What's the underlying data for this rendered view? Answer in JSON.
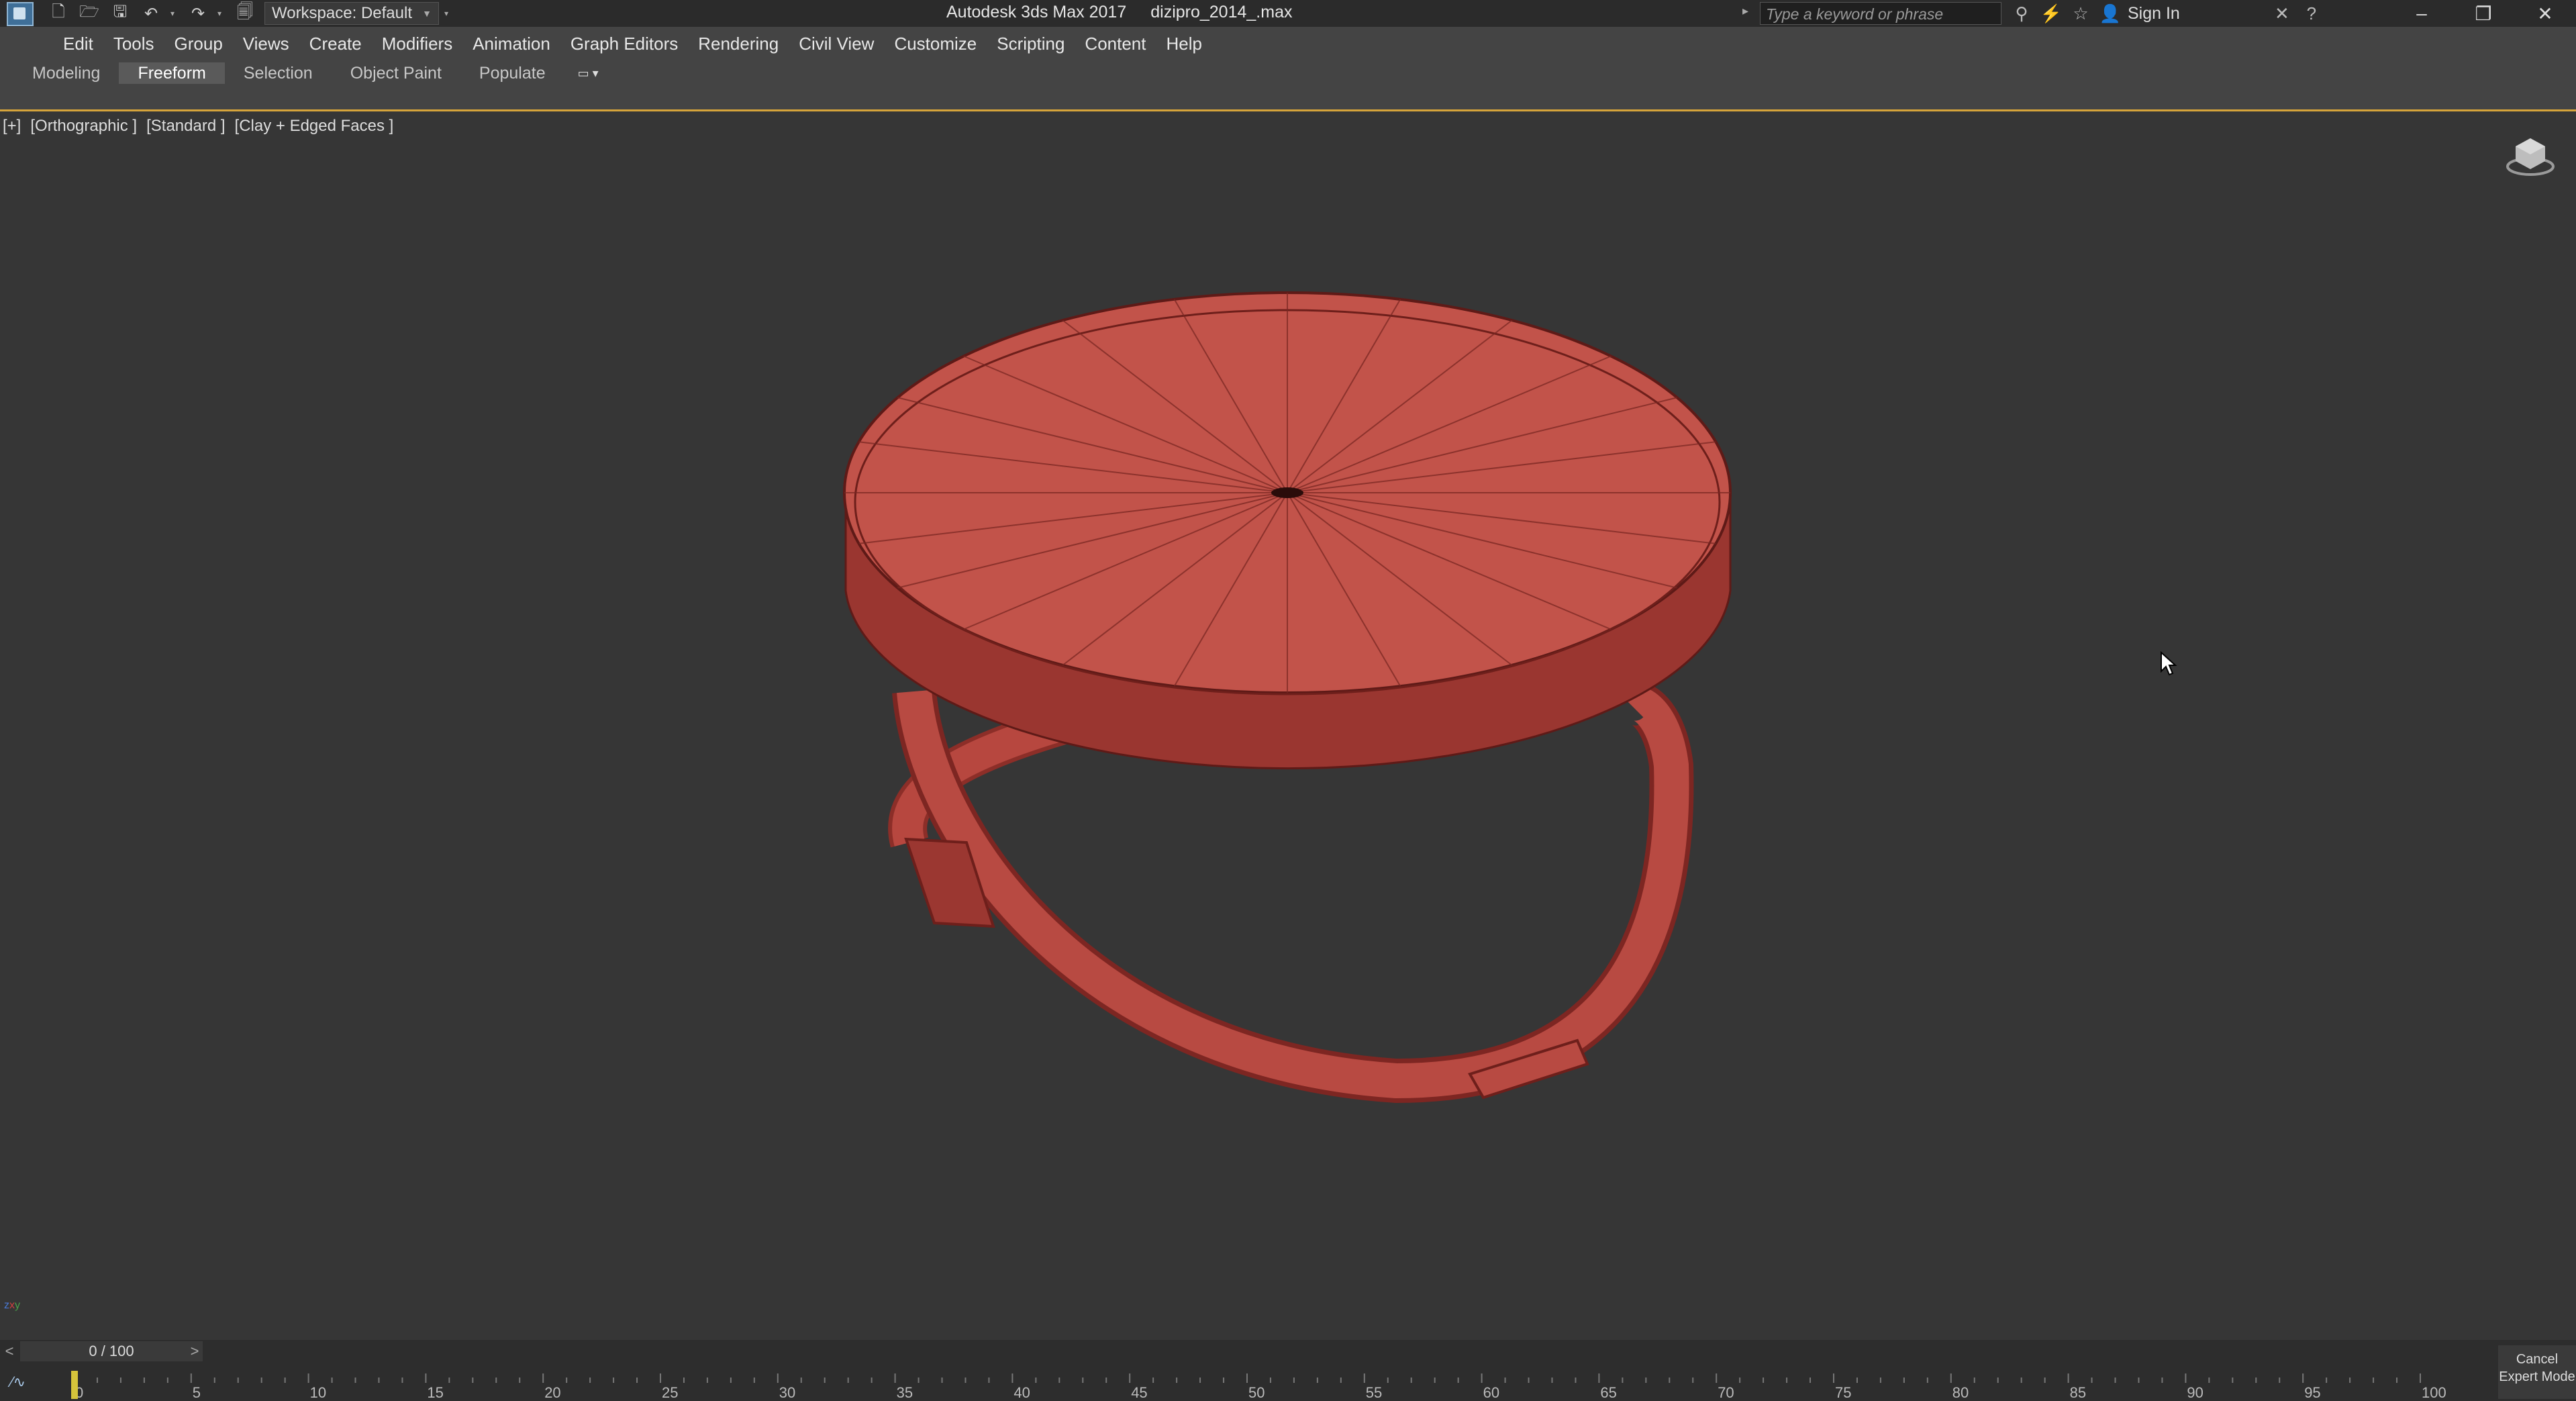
{
  "app": {
    "title": "Autodesk 3ds Max 2017",
    "file": "dizipro_2014_.max",
    "workspace_label": "Workspace: Default"
  },
  "search": {
    "placeholder": "Type a keyword or phrase"
  },
  "account": {
    "signin_label": "Sign In"
  },
  "menu": [
    "Edit",
    "Tools",
    "Group",
    "Views",
    "Create",
    "Modifiers",
    "Animation",
    "Graph Editors",
    "Rendering",
    "Civil View",
    "Customize",
    "Scripting",
    "Content",
    "Help"
  ],
  "ribbon_tabs": [
    {
      "label": "Modeling",
      "active": false
    },
    {
      "label": "Freeform",
      "active": true
    },
    {
      "label": "Selection",
      "active": false
    },
    {
      "label": "Object Paint",
      "active": false
    },
    {
      "label": "Populate",
      "active": false
    }
  ],
  "viewport": {
    "labels": [
      "[+]",
      "[Orthographic ]",
      "[Standard ]",
      "[Clay + Edged Faces ]"
    ],
    "object_color": "#b84a42"
  },
  "timeline": {
    "frame_display": "0 / 100",
    "prev_label": "<",
    "next_label": ">",
    "ticks": [
      "0",
      "5",
      "10",
      "15",
      "20",
      "25",
      "30",
      "35",
      "40",
      "45",
      "50",
      "55",
      "60",
      "65",
      "70",
      "75",
      "80",
      "85",
      "90",
      "95",
      "100"
    ],
    "current_frame": 0,
    "total_frames": 100
  },
  "status": {
    "cancel_label": "Cancel",
    "expert_label": "Expert Mode"
  },
  "colors": {
    "accent": "#d6a43b",
    "viewport_bg": "#363636",
    "ui_bg": "#444444"
  }
}
